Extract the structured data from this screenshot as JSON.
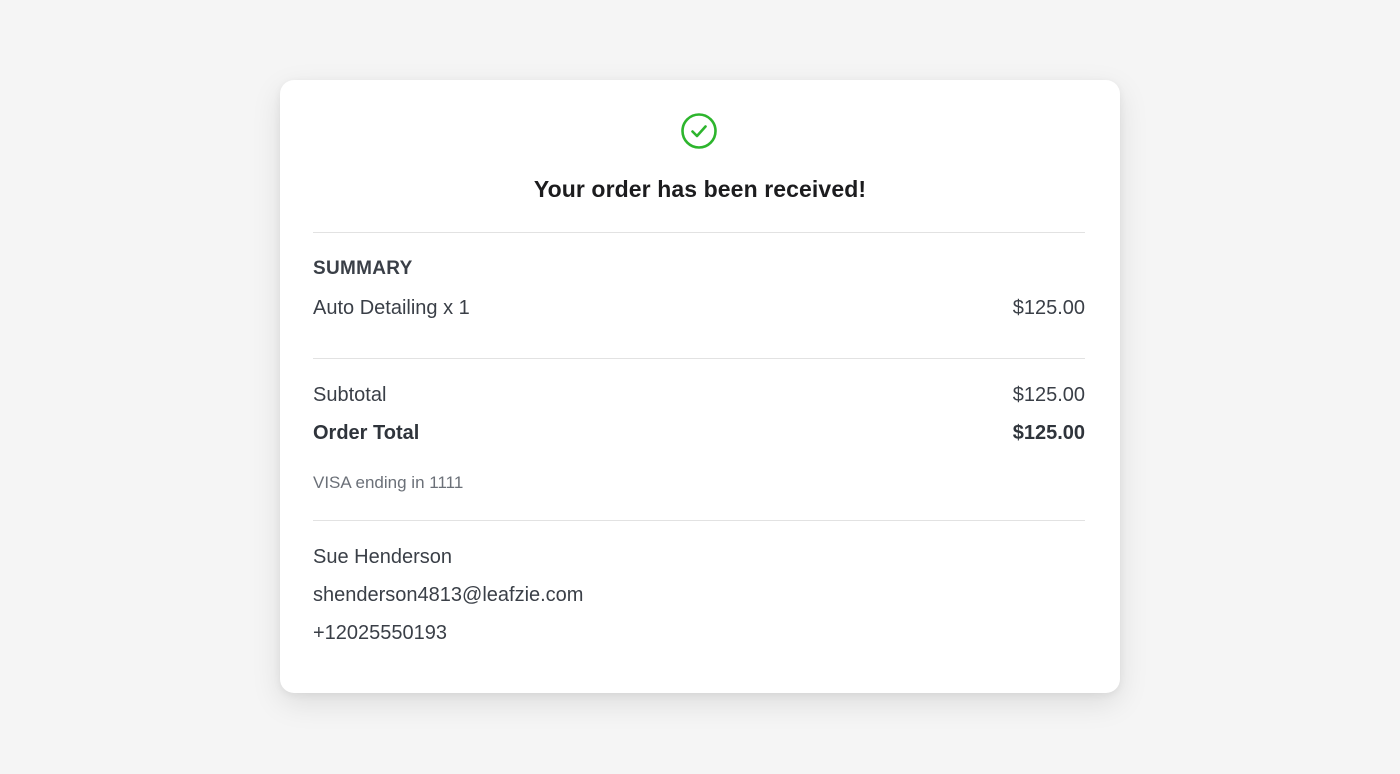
{
  "confirmation": {
    "title": "Your order has been received!",
    "icon": "check-circle-icon",
    "icon_color": "#2db52d"
  },
  "summary": {
    "heading": "SUMMARY",
    "items": [
      {
        "label": "Auto Detailing x 1",
        "price": "$125.00"
      }
    ]
  },
  "totals": {
    "subtotal_label": "Subtotal",
    "subtotal_value": "$125.00",
    "total_label": "Order Total",
    "total_value": "$125.00"
  },
  "payment": {
    "method": "VISA ending in 1111"
  },
  "customer": {
    "name": "Sue Henderson",
    "email": "shenderson4813@leafzie.com",
    "phone": "+12025550193"
  }
}
